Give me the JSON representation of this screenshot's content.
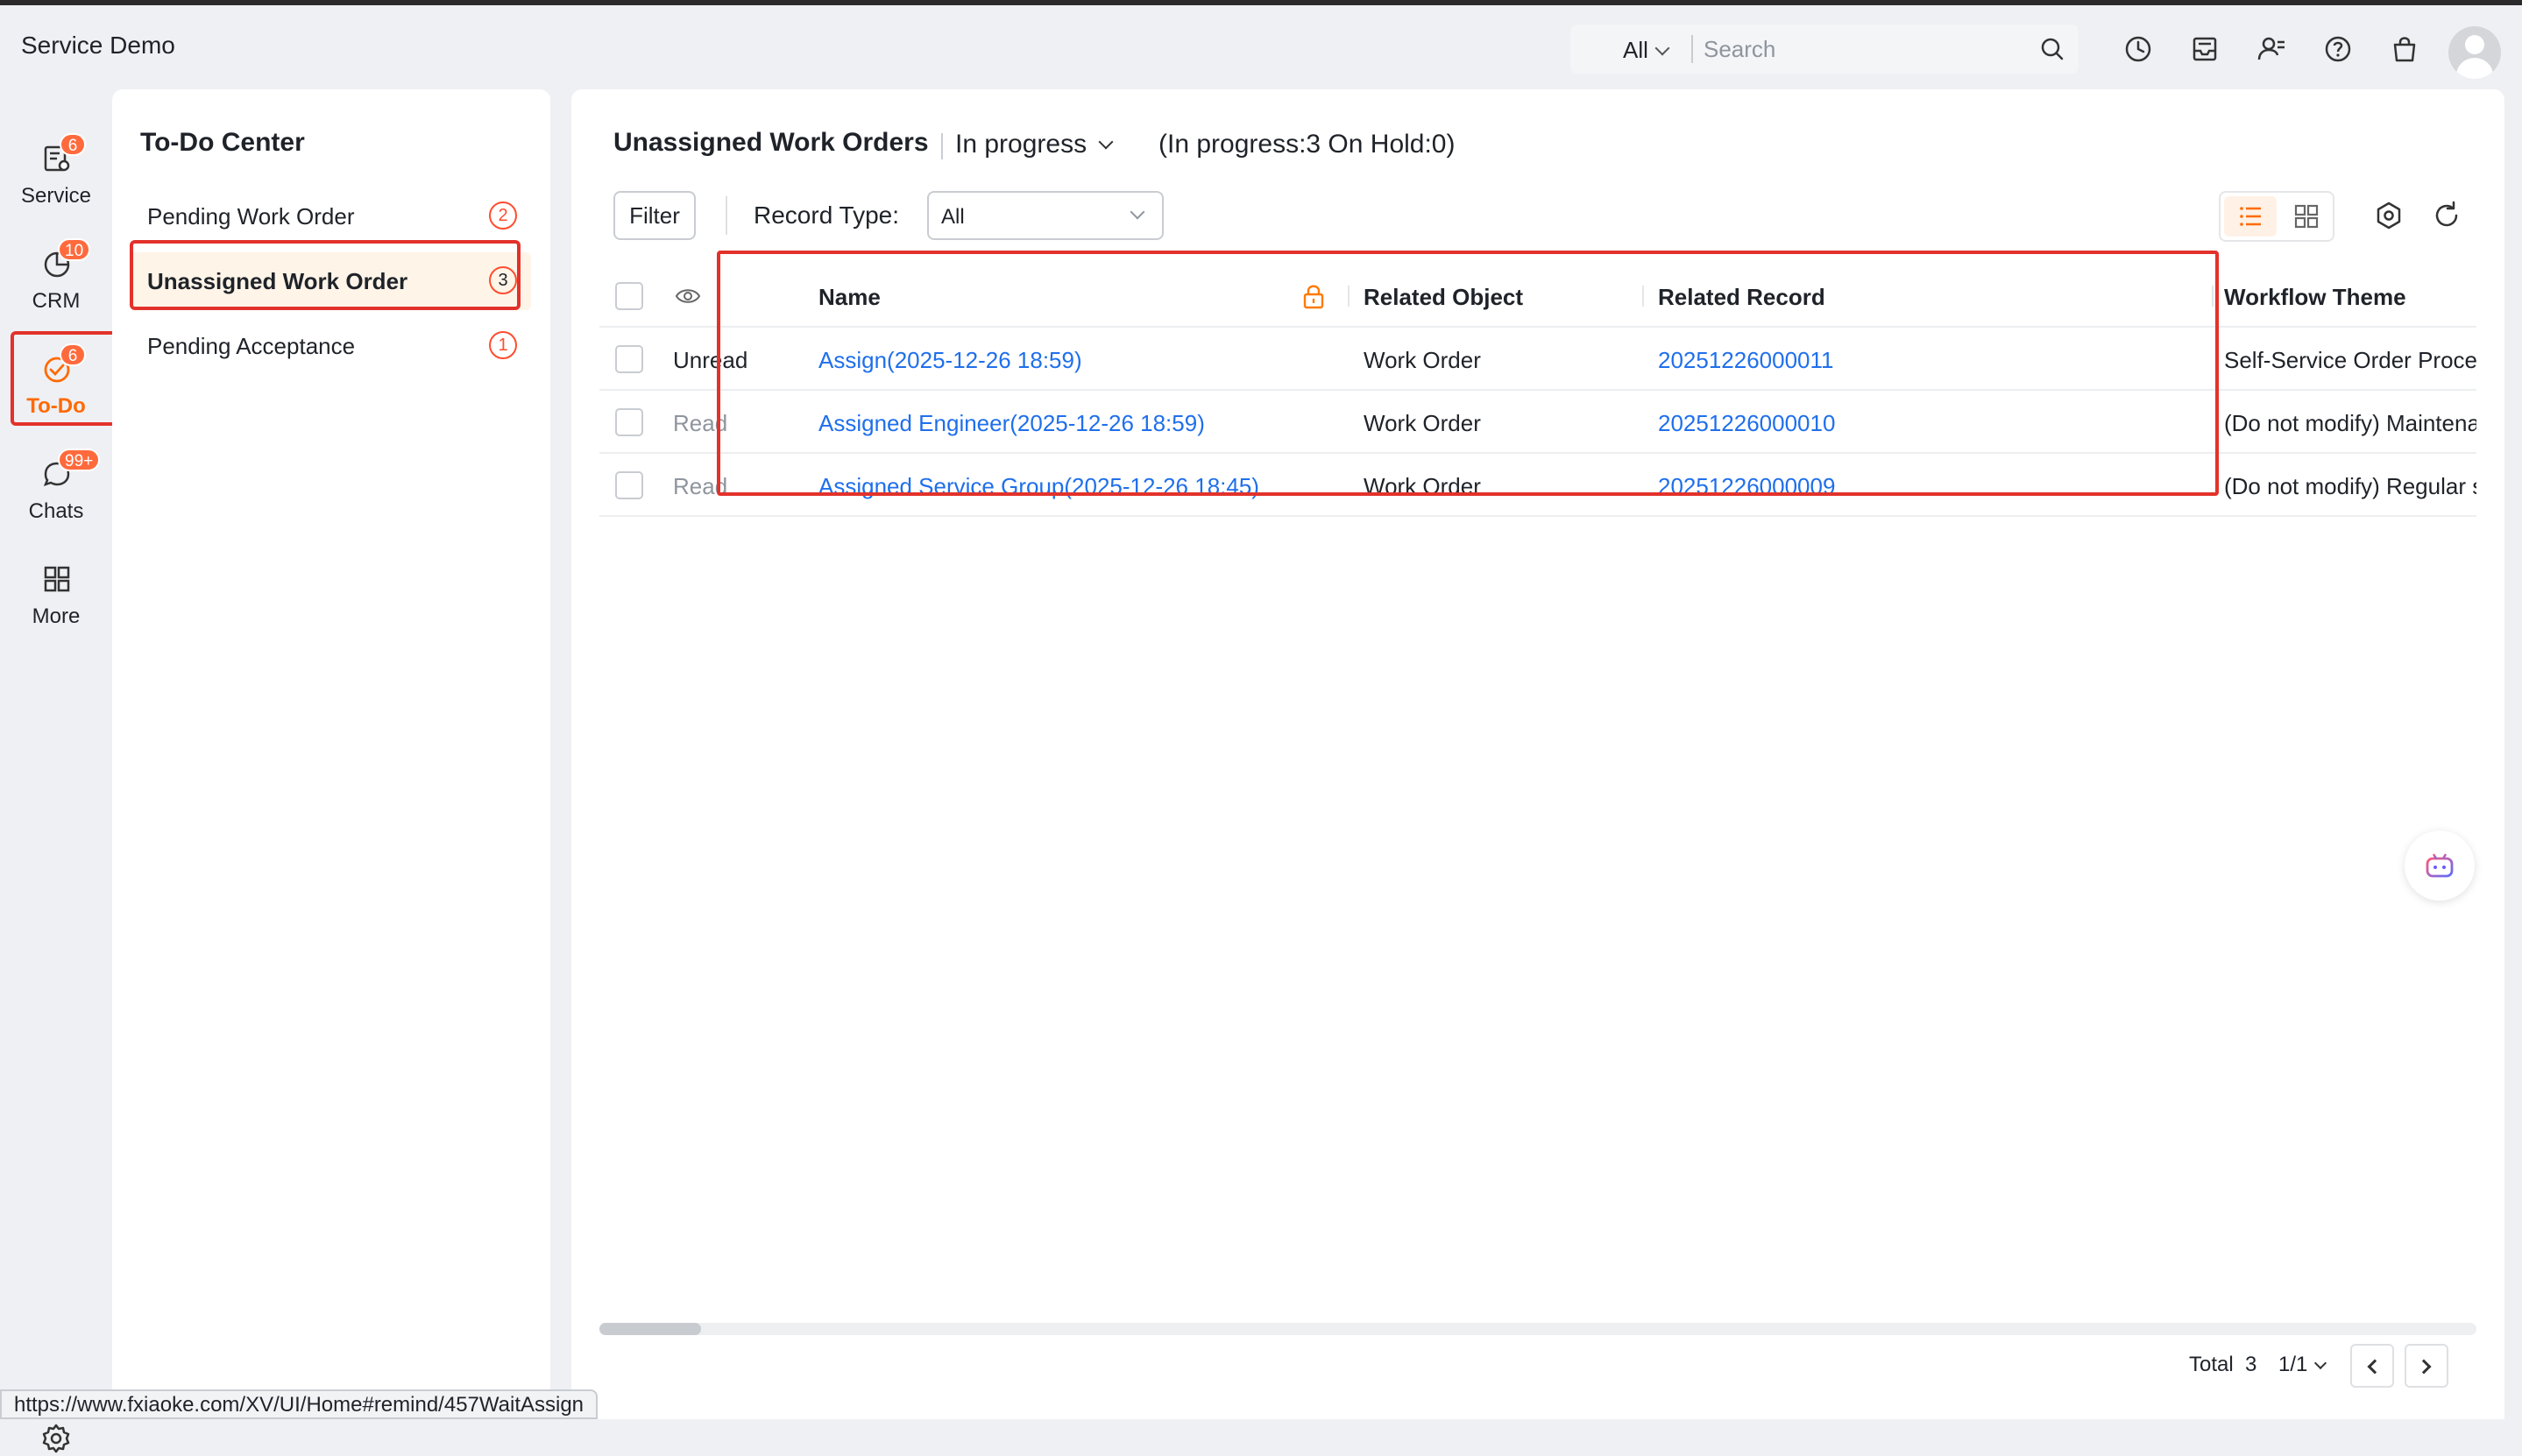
{
  "app": {
    "title": "Service Demo"
  },
  "search": {
    "scope": "All",
    "placeholder": "Search"
  },
  "nav": {
    "items": [
      {
        "label": "Service",
        "badge": "6"
      },
      {
        "label": "CRM",
        "badge": "10"
      },
      {
        "label": "To-Do",
        "badge": "6"
      },
      {
        "label": "Chats",
        "badge": "99+"
      },
      {
        "label": "More"
      }
    ]
  },
  "todo_center": {
    "title": "To-Do Center",
    "items": [
      {
        "label": "Pending Work Order",
        "count": "2"
      },
      {
        "label": "Unassigned Work Order",
        "count": "3"
      },
      {
        "label": "Pending Acceptance",
        "count": "1"
      }
    ]
  },
  "main": {
    "title": "Unassigned Work Orders",
    "status": "In progress",
    "summary": "(In progress:3 On Hold:0)",
    "filter_label": "Filter",
    "record_type_label": "Record Type:",
    "record_type_value": "All",
    "columns": [
      "Name",
      "Related Object",
      "Related Record",
      "Workflow Theme"
    ],
    "rows": [
      {
        "read_status": "Unread",
        "name": "Assign(2025-12-26 18:59)",
        "related_object": "Work Order",
        "related_record": "20251226000011",
        "workflow_theme": "Self-Service Order Process"
      },
      {
        "read_status": "Read",
        "name": "Assigned Engineer(2025-12-26 18:59)",
        "related_object": "Work Order",
        "related_record": "20251226000010",
        "workflow_theme": "(Do not modify) Maintenanc"
      },
      {
        "read_status": "Read",
        "name": "Assigned Service Group(2025-12-26 18:45)",
        "related_object": "Work Order",
        "related_record": "20251226000009",
        "workflow_theme": "(Do not modify) Regular ser"
      }
    ]
  },
  "pager": {
    "total_label": "Total",
    "total": "3",
    "pages": "1/1"
  },
  "status_bar": {
    "url": "https://www.fxiaoke.com/XV/UI/Home#remind/457WaitAssign"
  },
  "colors": {
    "accent": "#ff6a00",
    "badge": "#ff6a3d",
    "link": "#1f6feb",
    "annotation": "#e2322b"
  }
}
